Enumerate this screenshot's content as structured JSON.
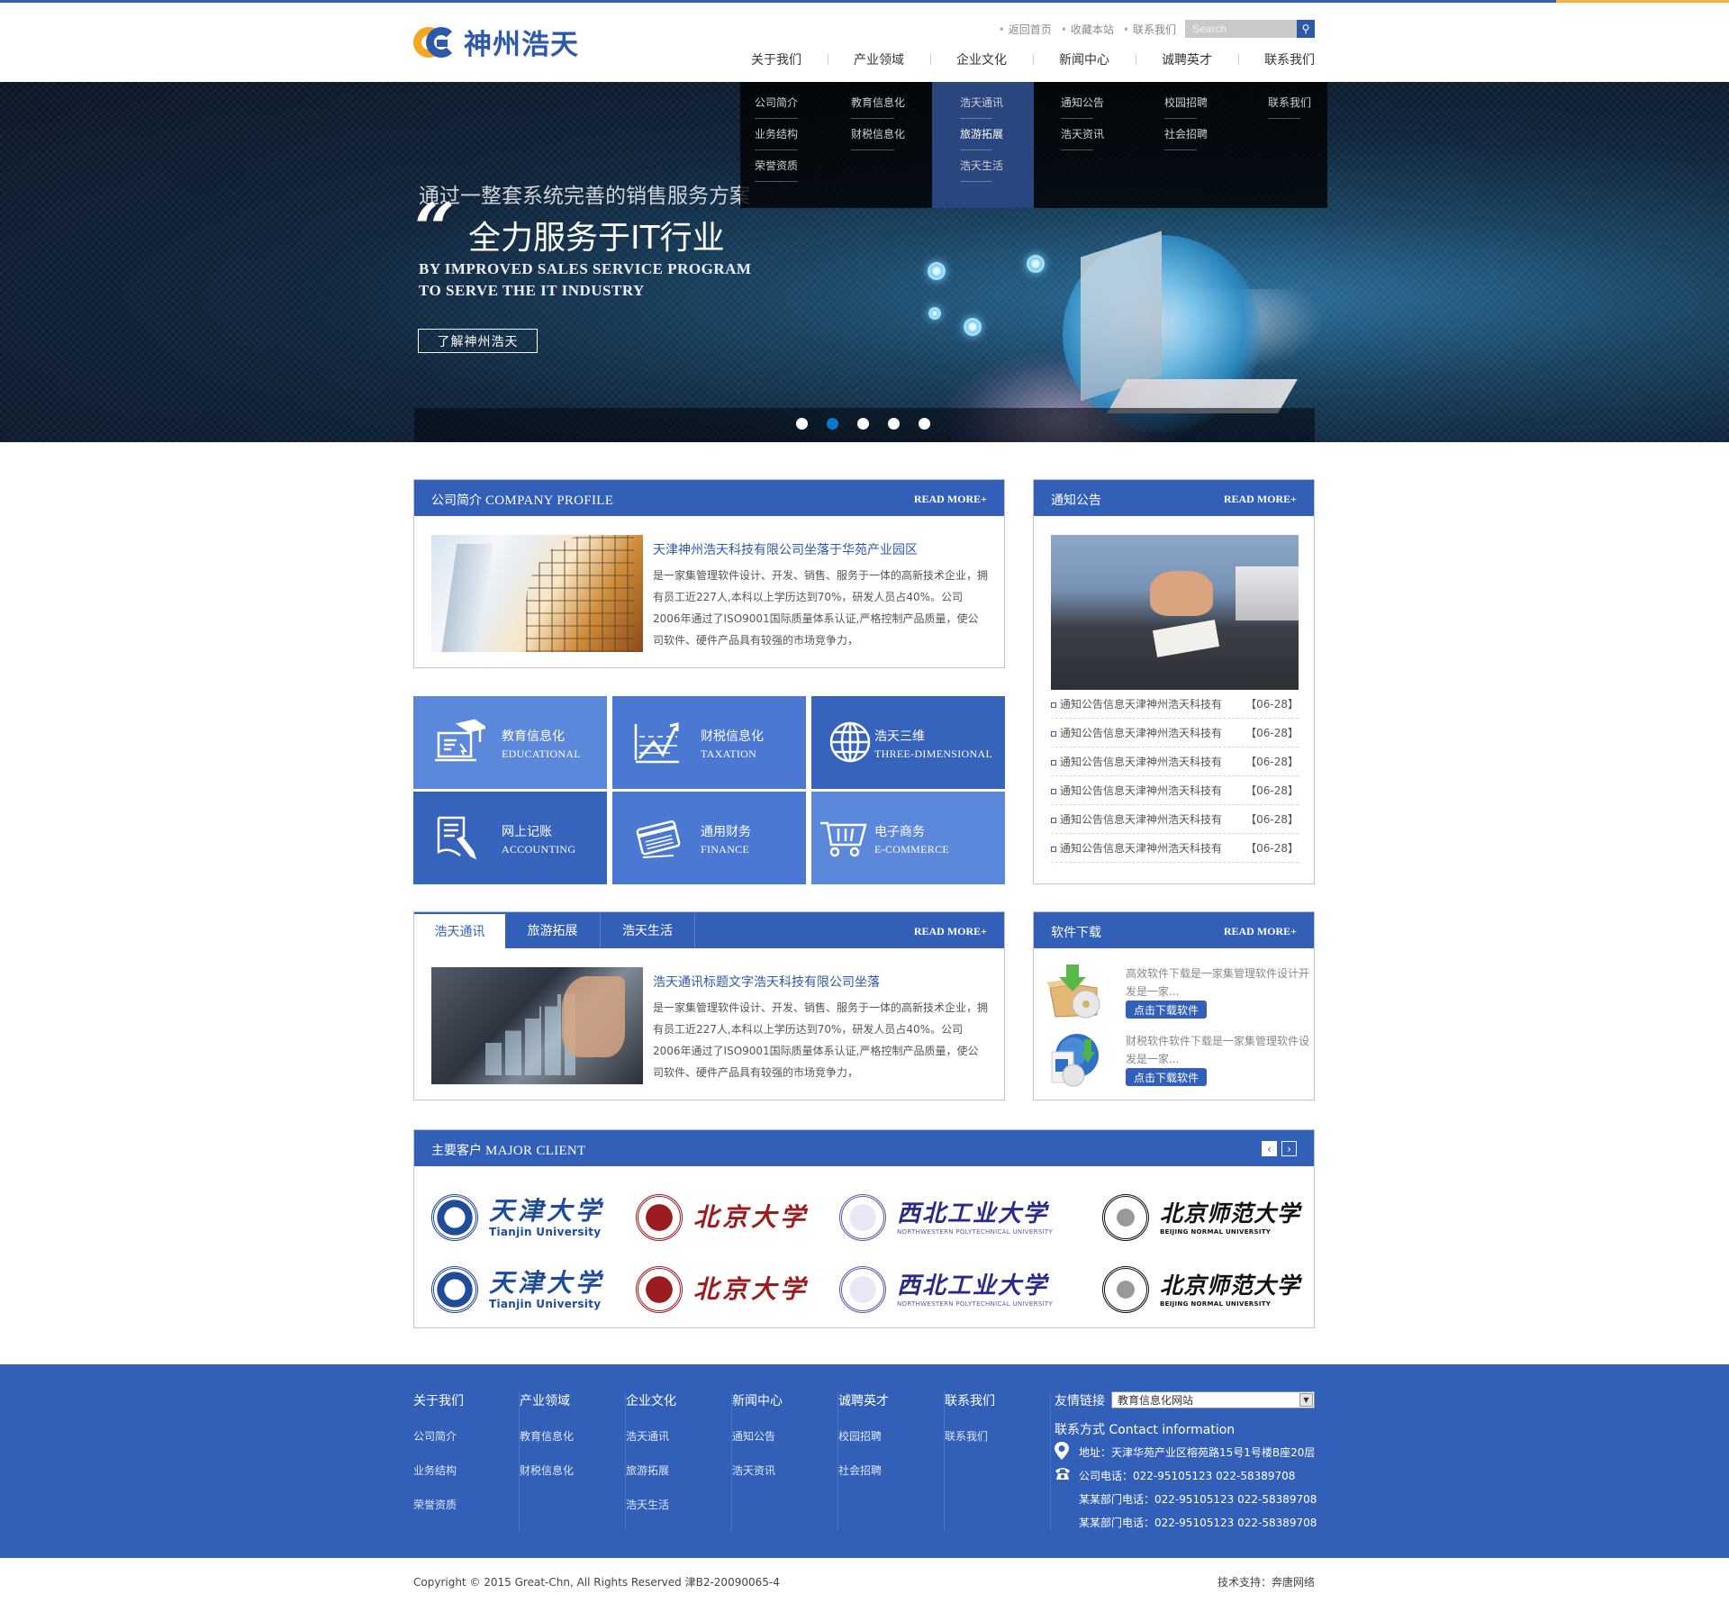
{
  "brand": {
    "name": "神州浩天",
    "accent": "#3260b8",
    "accent_orange": "#f5a623"
  },
  "toplinks": [
    "返回首页",
    "收藏本站",
    "联系我们"
  ],
  "search": {
    "placeholder": "Search",
    "icon": "search-icon"
  },
  "nav": [
    "关于我们",
    "产业领域",
    "企业文化",
    "新闻中心",
    "诚聘英才",
    "联系我们"
  ],
  "dropdown": {
    "columns": [
      {
        "items": [
          "公司简介",
          "业务结构",
          "荣誉资质"
        ]
      },
      {
        "items": [
          "教育信息化",
          "财税信息化"
        ]
      },
      {
        "items": [
          "浩天通讯",
          "旅游拓展",
          "浩天生活"
        ],
        "active": true,
        "highlighted": "旅游拓展"
      },
      {
        "items": [
          "通知公告",
          "浩天资讯"
        ]
      },
      {
        "items": [
          "校园招聘",
          "社会招聘"
        ]
      },
      {
        "items": [
          "联系我们"
        ]
      }
    ]
  },
  "banner": {
    "line1": "通过一整套系统完善的销售服务方案",
    "quote_mark": "“",
    "line2": "全力服务于IT行业",
    "line3a": "BY IMPROVED SALES SERVICE PROGRAM",
    "line3b": "TO SERVE THE IT INDUSTRY",
    "button": "了解神州浩天",
    "slides": 5,
    "active_slide": 2
  },
  "profile": {
    "title_cn": "公司简介",
    "title_en": "COMPANY PROFILE",
    "more": "READ MORE+",
    "headline": "天津神州浩天科技有限公司坐落于华苑产业园区",
    "body": "是一家集管理软件设计、开发、销售、服务于一体的高新技术企业，拥有员工近227人,本科以上学历达到70%，研发人员占40%。公司2006年通过了ISO9001国际质量体系认证,严格控制产品质量，使公司软件、硬件产品具有较强的市场竞争力，"
  },
  "notice": {
    "title": "通知公告",
    "more": "READ MORE+",
    "items": [
      {
        "text": "通知公告信息天津神州浩天科技有",
        "date": "【06-28】"
      },
      {
        "text": "通知公告信息天津神州浩天科技有",
        "date": "【06-28】"
      },
      {
        "text": "通知公告信息天津神州浩天科技有",
        "date": "【06-28】"
      },
      {
        "text": "通知公告信息天津神州浩天科技有",
        "date": "【06-28】"
      },
      {
        "text": "通知公告信息天津神州浩天科技有",
        "date": "【06-28】"
      },
      {
        "text": "通知公告信息天津神州浩天科技有",
        "date": "【06-28】"
      }
    ]
  },
  "services": [
    {
      "cn": "教育信息化",
      "en": "EDUCATIONAL",
      "icon": "education-laptop-icon"
    },
    {
      "cn": "财税信息化",
      "en": "TAXATION",
      "icon": "chart-trend-icon"
    },
    {
      "cn": "浩天三维",
      "en": "THREE-DIMENSIONAL",
      "icon": "globe-icon"
    },
    {
      "cn": "网上记账",
      "en": "ACCOUNTING",
      "icon": "document-pen-icon"
    },
    {
      "cn": "通用财务",
      "en": "FINANCE",
      "icon": "credit-card-icon"
    },
    {
      "cn": "电子商务",
      "en": "E-COMMERCE",
      "icon": "shopping-cart-icon"
    }
  ],
  "news": {
    "tabs": [
      "浩天通讯",
      "旅游拓展",
      "浩天生活"
    ],
    "active_tab": 0,
    "more": "READ MORE+",
    "headline": "浩天通讯标题文字浩天科技有限公司坐落",
    "body": "是一家集管理软件设计、开发、销售、服务于一体的高新技术企业，拥有员工近227人,本科以上学历达到70%，研发人员占40%。公司2006年通过了ISO9001国际质量体系认证,严格控制产品质量，使公司软件、硬件产品具有较强的市场竞争力，"
  },
  "downloads": {
    "title": "软件下载",
    "more": "READ MORE+",
    "items": [
      {
        "text": "高效软件下载是一家集管理软件设计开发是一家...",
        "button": "点击下载软件"
      },
      {
        "text": "财税软件软件下载是一家集管理软件设发是一家...",
        "button": "点击下载软件"
      }
    ]
  },
  "clients": {
    "title_cn": "主要客户",
    "title_en": "MAJOR CLIENT",
    "prev": "‹",
    "next": "›",
    "rows": [
      [
        {
          "zh": "天津大学",
          "en": "Tianjin University",
          "color": "#1f4b99"
        },
        {
          "zh": "北京大学",
          "en": "",
          "color": "#9b1c1f"
        },
        {
          "zh": "西北工业大学",
          "en": "NORTHWESTERN POLYTECHNICAL UNIVERSITY",
          "color": "#2a2a8a"
        },
        {
          "zh": "北京师范大学",
          "en": "BEIJING NORMAL UNIVERSITY",
          "color": "#111111"
        }
      ],
      [
        {
          "zh": "天津大学",
          "en": "Tianjin University",
          "color": "#1f4b99"
        },
        {
          "zh": "北京大学",
          "en": "",
          "color": "#9b1c1f"
        },
        {
          "zh": "西北工业大学",
          "en": "NORTHWESTERN POLYTECHNICAL UNIVERSITY",
          "color": "#2a2a8a"
        },
        {
          "zh": "北京师范大学",
          "en": "BEIJING NORMAL UNIVERSITY",
          "color": "#111111"
        }
      ]
    ]
  },
  "footer": {
    "columns": [
      {
        "title": "关于我们",
        "links": [
          "公司简介",
          "业务结构",
          "荣誉资质"
        ]
      },
      {
        "title": "产业领域",
        "links": [
          "教育信息化",
          "财税信息化"
        ]
      },
      {
        "title": "企业文化",
        "links": [
          "浩天通讯",
          "旅游拓展",
          "浩天生活"
        ]
      },
      {
        "title": "新闻中心",
        "links": [
          "通知公告",
          "浩天资讯"
        ]
      },
      {
        "title": "诚聘英才",
        "links": [
          "校园招聘",
          "社会招聘"
        ]
      },
      {
        "title": "联系我们",
        "links": [
          "联系我们"
        ]
      }
    ],
    "friend_links_label": "友情链接",
    "friend_links_selected": "教育信息化网站",
    "contact_title": "联系方式 Contact information",
    "address": "地址：天津华苑产业区榕苑路15号1号楼B座20层",
    "phone": "公司电话：022-95105123 022-58389708",
    "dept_phone_1": "某某部门电话：022-95105123 022-58389708",
    "dept_phone_2": "某某部门电话：022-95105123 022-58389708"
  },
  "copyright": "Copyright © 2015 Great-Chn, All Rights Reserved  津B2-20090065-4",
  "support": "技术支持：奔唐网络"
}
